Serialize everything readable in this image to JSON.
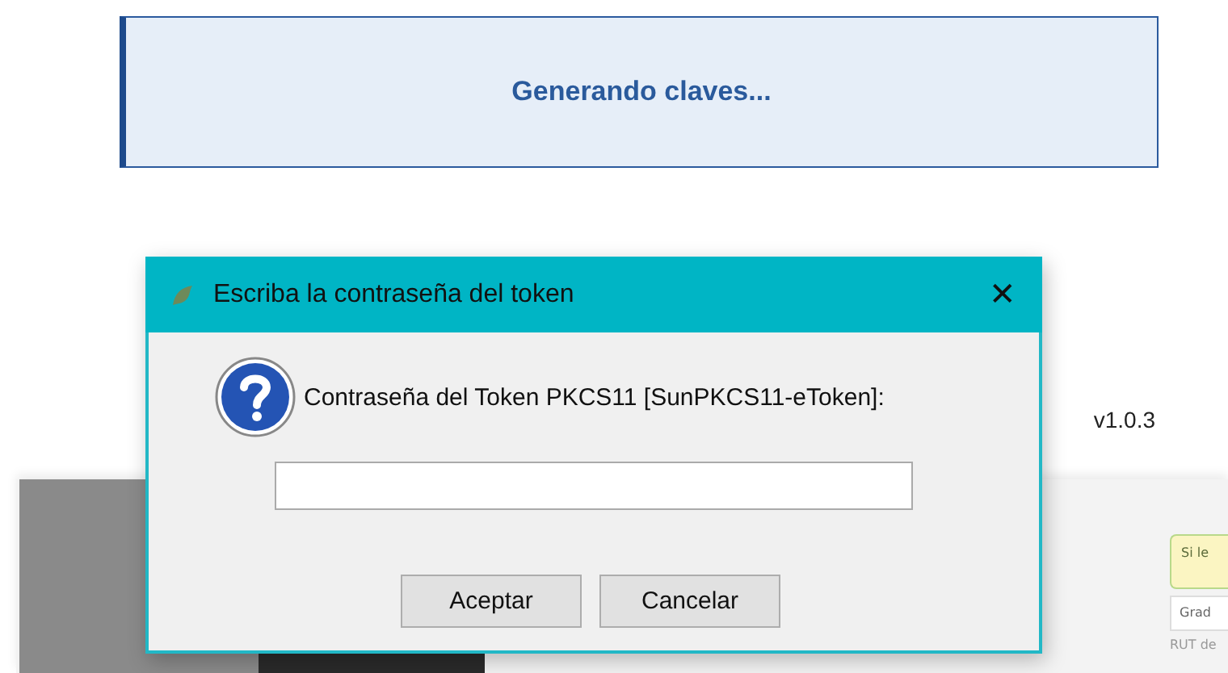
{
  "banner": {
    "text": "Generando claves..."
  },
  "version": "v1.0.3",
  "background_panel": {
    "note": "Si le",
    "field": "Grad",
    "field_label": "RUT de"
  },
  "dialog": {
    "title": "Escriba la contraseña del token",
    "close": "✕",
    "prompt": "Contraseña del Token PKCS11 [SunPKCS11-eToken]:",
    "buttons": [
      {
        "label": "Aceptar"
      },
      {
        "label": "Cancelar"
      }
    ]
  }
}
